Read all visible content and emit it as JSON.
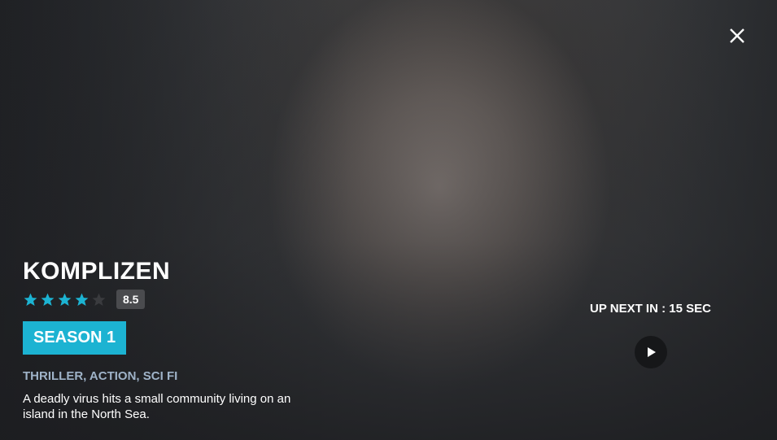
{
  "show": {
    "title": "KOMPLIZEN",
    "rating_value": "8.5",
    "stars_filled": 4,
    "stars_total": 5,
    "season_label": "SEASON 1",
    "genres": "THRILLER, ACTION, SCI FI",
    "synopsis": "A deadly virus hits a small community living on an island in the North Sea."
  },
  "up_next": {
    "label": "UP NEXT IN : 15 SEC"
  },
  "colors": {
    "accent": "#1cb3d2",
    "star_filled": "#1cb3d2",
    "star_empty": "#3a3b3e",
    "genre_text": "#9fb3c8"
  },
  "icons": {
    "close": "close-icon",
    "play": "play-icon",
    "star": "star-icon"
  }
}
